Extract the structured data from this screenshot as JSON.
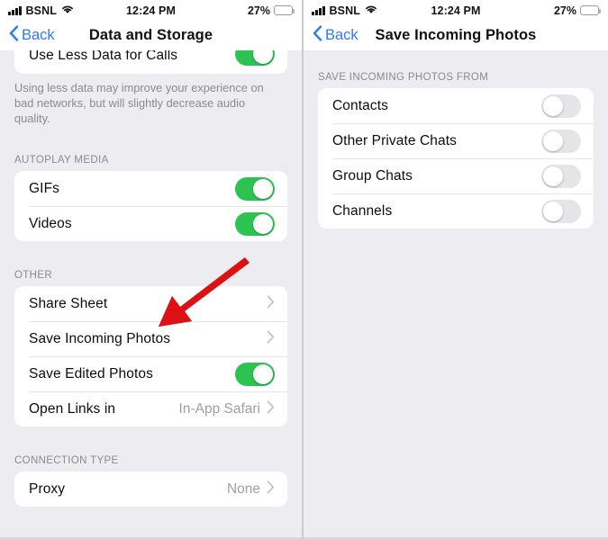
{
  "status_bar": {
    "carrier": "BSNL",
    "signal_icon": "signal-bars-icon",
    "wifi_icon": "wifi-icon",
    "time": "12:24 PM",
    "battery_percent": "27%",
    "battery_icon": "battery-icon"
  },
  "left_panel": {
    "nav": {
      "back_label": "Back",
      "back_icon": "chevron-left-icon",
      "title": "Data and Storage"
    },
    "calls_group": {
      "row": {
        "label": "Use Less Data for Calls",
        "toggle_state": "on"
      },
      "footer": "Using less data may improve your experience on bad networks, but will slightly decrease audio quality."
    },
    "autoplay_group": {
      "header": "AUTOPLAY MEDIA",
      "rows": [
        {
          "label": "GIFs",
          "toggle_state": "on"
        },
        {
          "label": "Videos",
          "toggle_state": "on"
        }
      ]
    },
    "other_group": {
      "header": "OTHER",
      "rows": [
        {
          "label": "Share Sheet",
          "value": "",
          "accessory": "chevron-right-icon"
        },
        {
          "label": "Save Incoming Photos",
          "value": "",
          "accessory": "chevron-right-icon"
        },
        {
          "label": "Save Edited Photos",
          "value": "",
          "accessory": "toggle",
          "toggle_state": "on"
        },
        {
          "label": "Open Links in",
          "value": "In-App Safari",
          "accessory": "chevron-right-icon"
        }
      ]
    },
    "connection_group": {
      "header": "CONNECTION TYPE",
      "rows": [
        {
          "label": "Proxy",
          "value": "None",
          "accessory": "chevron-right-icon"
        }
      ]
    }
  },
  "right_panel": {
    "nav": {
      "back_label": "Back",
      "back_icon": "chevron-left-icon",
      "title": "Save Incoming Photos"
    },
    "sources_group": {
      "header": "SAVE INCOMING PHOTOS FROM",
      "rows": [
        {
          "label": "Contacts",
          "toggle_state": "off"
        },
        {
          "label": "Other Private Chats",
          "toggle_state": "off"
        },
        {
          "label": "Group Chats",
          "toggle_state": "off"
        },
        {
          "label": "Channels",
          "toggle_state": "off"
        }
      ]
    }
  },
  "annotation": {
    "arrow_icon": "red-arrow-icon",
    "arrow_color": "#dd1111",
    "points_to": "Save Incoming Photos"
  },
  "colors": {
    "accent_blue": "#2f7cf6",
    "toggle_on_green": "#2cc351",
    "toggle_off_grey": "#e5e5e8",
    "page_background": "#ececf1",
    "card_background": "#ffffff",
    "secondary_text": "#8a8a92"
  }
}
